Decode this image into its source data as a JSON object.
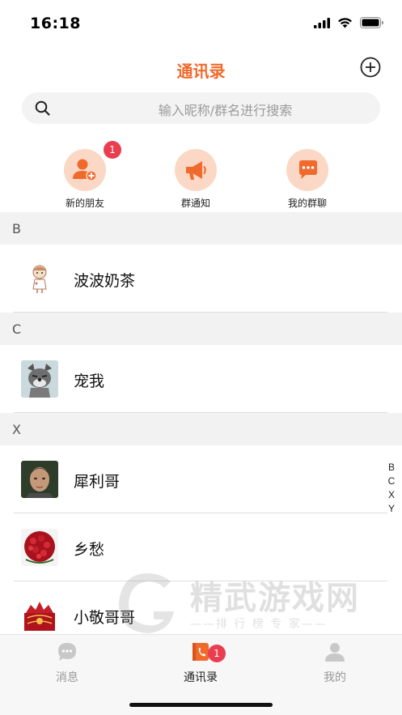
{
  "status": {
    "time": "16:18"
  },
  "header": {
    "title": "通讯录",
    "add_icon": "plus-circle-icon"
  },
  "search": {
    "placeholder": "输入昵称/群名进行搜索"
  },
  "quick_actions": [
    {
      "label": "新的朋友",
      "icon": "add-user-icon",
      "badge": "1"
    },
    {
      "label": "群通知",
      "icon": "megaphone-icon"
    },
    {
      "label": "我的群聊",
      "icon": "chat-bubbles-icon"
    }
  ],
  "contacts": [
    {
      "letter": "B",
      "items": [
        {
          "name": "波波奶茶"
        }
      ]
    },
    {
      "letter": "C",
      "items": [
        {
          "name": "宠我"
        }
      ]
    },
    {
      "letter": "X",
      "items": [
        {
          "name": "犀利哥"
        },
        {
          "name": "乡愁"
        },
        {
          "name": "小敬哥哥"
        }
      ]
    }
  ],
  "index_letters": [
    "B",
    "C",
    "X",
    "Y"
  ],
  "watermark": {
    "title": "精武游戏网",
    "subtitle": "——排 行 榜 专 家——"
  },
  "tabs": [
    {
      "label": "消息",
      "icon": "chat-icon",
      "active": false
    },
    {
      "label": "通讯录",
      "icon": "contacts-icon",
      "active": true,
      "badge": "1"
    },
    {
      "label": "我的",
      "icon": "person-icon",
      "active": false
    }
  ],
  "colors": {
    "accent": "#f06a2c",
    "badge": "#ea3e4f",
    "quick_bg": "#fbd8c6"
  }
}
